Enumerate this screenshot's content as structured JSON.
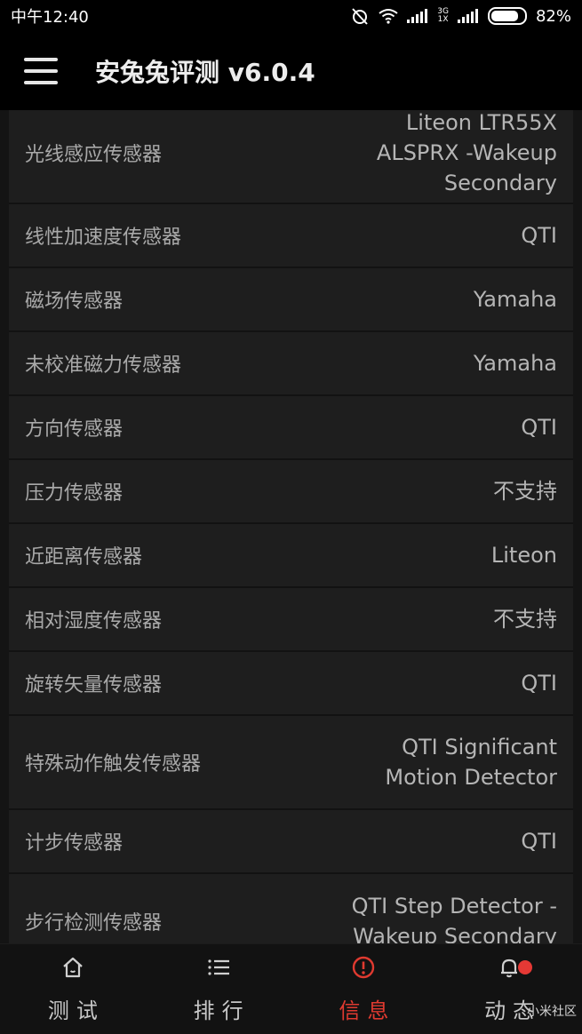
{
  "status_bar": {
    "time": "中午12:40",
    "network": "3G\n1X",
    "battery": "82%",
    "battery_level": 0.82
  },
  "app_bar": {
    "title": "安兔兔评测 v6.0.4"
  },
  "list": [
    {
      "label": "光线感应传感器",
      "value": "Liteon LTR55X\nALSPRX -Wakeup\nSecondary"
    },
    {
      "label": "线性加速度传感器",
      "value": "QTI"
    },
    {
      "label": "磁场传感器",
      "value": "Yamaha"
    },
    {
      "label": "未校准磁力传感器",
      "value": "Yamaha"
    },
    {
      "label": "方向传感器",
      "value": "QTI"
    },
    {
      "label": "压力传感器",
      "value": "不支持"
    },
    {
      "label": "近距离传感器",
      "value": "Liteon"
    },
    {
      "label": "相对湿度传感器",
      "value": "不支持"
    },
    {
      "label": "旋转矢量传感器",
      "value": "QTI"
    },
    {
      "label": "特殊动作触发传感器",
      "value": "QTI Significant\nMotion Detector"
    },
    {
      "label": "计步传感器",
      "value": "QTI"
    },
    {
      "label": "步行检测传感器",
      "value": "QTI Step Detector -\nWakeup Secondary"
    }
  ],
  "bottom_nav": [
    {
      "label": "测试",
      "icon": "home-icon"
    },
    {
      "label": "排行",
      "icon": "list-icon"
    },
    {
      "label": "信息",
      "icon": "info-alert-icon",
      "active": true
    },
    {
      "label": "动态",
      "icon": "bell-icon",
      "badge": true
    }
  ],
  "watermark": "小米社区",
  "colors": {
    "accent": "#e03a30",
    "background": "#1e1e1e",
    "bar": "#000000"
  }
}
